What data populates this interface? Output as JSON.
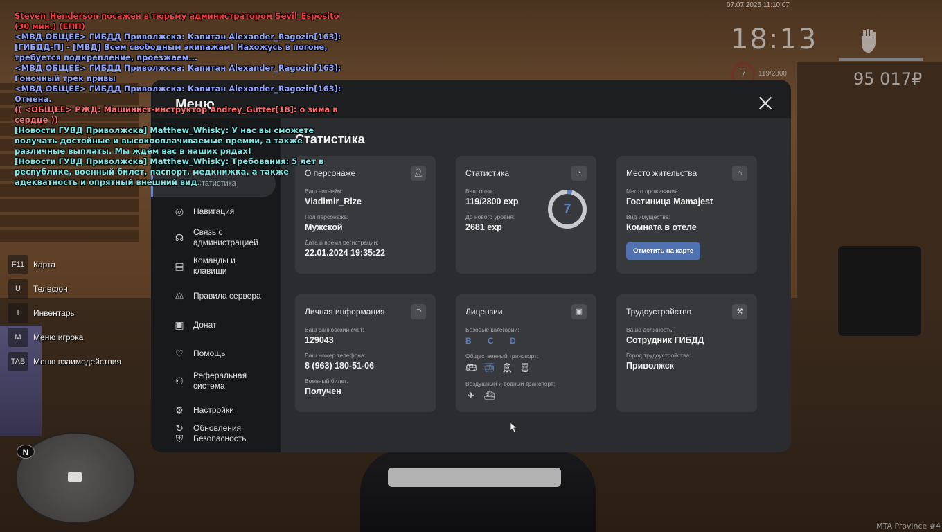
{
  "chat": [
    {
      "text": "Steven_Henderson посажен в тюрьму администратором Sevil_Esposito (30 мин.) (ЕПП)",
      "color": "#ff4040"
    },
    {
      "text": "<МВД.ОБЩЕЕ> ГИБДД Приволжска: Капитан Alexander_Ragozin[163]: [ГИБДД-П] - [МВД] Всем свободным экипажам! Нахожусь в погоне, требуется подкрепление, проезжаем...",
      "color": "#8ea4ff"
    },
    {
      "text": "<МВД.ОБЩЕЕ> ГИБДД Приволжска: Капитан Alexander_Ragozin[163]: Гоночный трек привы",
      "color": "#8ea4ff"
    },
    {
      "text": "<МВД.ОБЩЕЕ> ГИБДД Приволжска: Капитан Alexander_Ragozin[163]: Отмена.",
      "color": "#8ea4ff"
    },
    {
      "text": "(( <ОБЩЕЕ> РЖД: Машинист-инструктор Andrey_Gutter[18]: о зима в сердце ))",
      "color": "#ff6b6b"
    },
    {
      "text": "[Новости ГУВД Приволжска] Matthew_Whisky: У нас вы сможете получать достойные и высокооплачиваемые премии, а также различные выплаты. Мы ждём вас в наших рядах!",
      "color": "#7fe6e6"
    },
    {
      "text": "[Новости ГУВД Приволжска] Matthew_Whisky: Требования: 5 лет в республике, военный билет, паспорт, медкнижка, а также адекватность и опрятный внешний вид.",
      "color": "#7fe6e6"
    }
  ],
  "hud": {
    "date": "07.07.2025 11:10:07",
    "time": "18:13",
    "level": "7",
    "xp": "119/2800",
    "money": "95 017₽"
  },
  "hotkeys": [
    {
      "key": "F11",
      "label": "Карта"
    },
    {
      "key": "U",
      "label": "Телефон"
    },
    {
      "key": "I",
      "label": "Инвентарь"
    },
    {
      "key": "M",
      "label": "Меню игрока"
    },
    {
      "key": "TAB",
      "label": "Меню взаимодействия"
    }
  ],
  "minimap": {
    "compass": "N"
  },
  "server": "MTA Province #4",
  "menu": {
    "title": "Меню",
    "active": "Статистика",
    "section_title": "Статистика",
    "nav": [
      {
        "label": "Навигация",
        "icon": "compass-icon",
        "glyph": "◎"
      },
      {
        "label": "Связь с администрацией",
        "icon": "headset-icon",
        "glyph": "☊"
      },
      {
        "label": "Команды и клавиши",
        "icon": "document-icon",
        "glyph": "▤"
      },
      {
        "label": "Правила сервера",
        "icon": "scales-icon",
        "glyph": "⚖"
      },
      {
        "label": "Донат",
        "icon": "wallet-icon",
        "glyph": "▣"
      },
      {
        "label": "Помощь",
        "icon": "heart-hands-icon",
        "glyph": "♡"
      },
      {
        "label": "Реферальная система",
        "icon": "referral-icon",
        "glyph": "⚇"
      },
      {
        "label": "Настройки",
        "icon": "gear-icon",
        "glyph": "⚙"
      },
      {
        "label": "Безопасность",
        "icon": "shield-icon",
        "glyph": "⛨"
      },
      {
        "label": "Обновления",
        "icon": "refresh-icon",
        "glyph": "↻"
      }
    ],
    "cards": {
      "character": {
        "title": "О персонаже",
        "nick_label": "Ваш никнейм:",
        "nick": "Vladimir_Rize",
        "gender_label": "Пол персонажа:",
        "gender": "Мужской",
        "reg_label": "Дата и время регистрации:",
        "reg": "22.01.2024 19:35:22"
      },
      "stats": {
        "title": "Статистика",
        "exp_label": "Ваш опыт:",
        "exp": "119/2800 exp",
        "next_label": "До нового уровня:",
        "next": "2681 exp",
        "level": "7",
        "progress": 0.0425
      },
      "residence": {
        "title": "Место жительства",
        "place_label": "Место проживания:",
        "place": "Гостиница Mamajest",
        "prop_label": "Вид имущества:",
        "prop": "Комната в отеле",
        "button": "Отметить на карте"
      },
      "personal": {
        "title": "Личная информация",
        "bank_label": "Ваш банковский счет:",
        "bank": "129043",
        "phone_label": "Ваш номер телефона:",
        "phone": "8 (963) 180-51-06",
        "military_label": "Военный билет:",
        "military": "Получен"
      },
      "licenses": {
        "title": "Лицензии",
        "base_label": "Базовые категории:",
        "base": "B C D",
        "public_label": "Общественный транспорт:",
        "air_label": "Воздушный и водный транспорт:"
      },
      "job": {
        "title": "Трудоустройство",
        "position_label": "Ваша должность:",
        "position": "Сотрудник ГИБДД",
        "city_label": "Город трудоустройства:",
        "city": "Приволжск"
      }
    }
  },
  "colors": {
    "accent": "#5071b0",
    "panel": "#38393d"
  }
}
